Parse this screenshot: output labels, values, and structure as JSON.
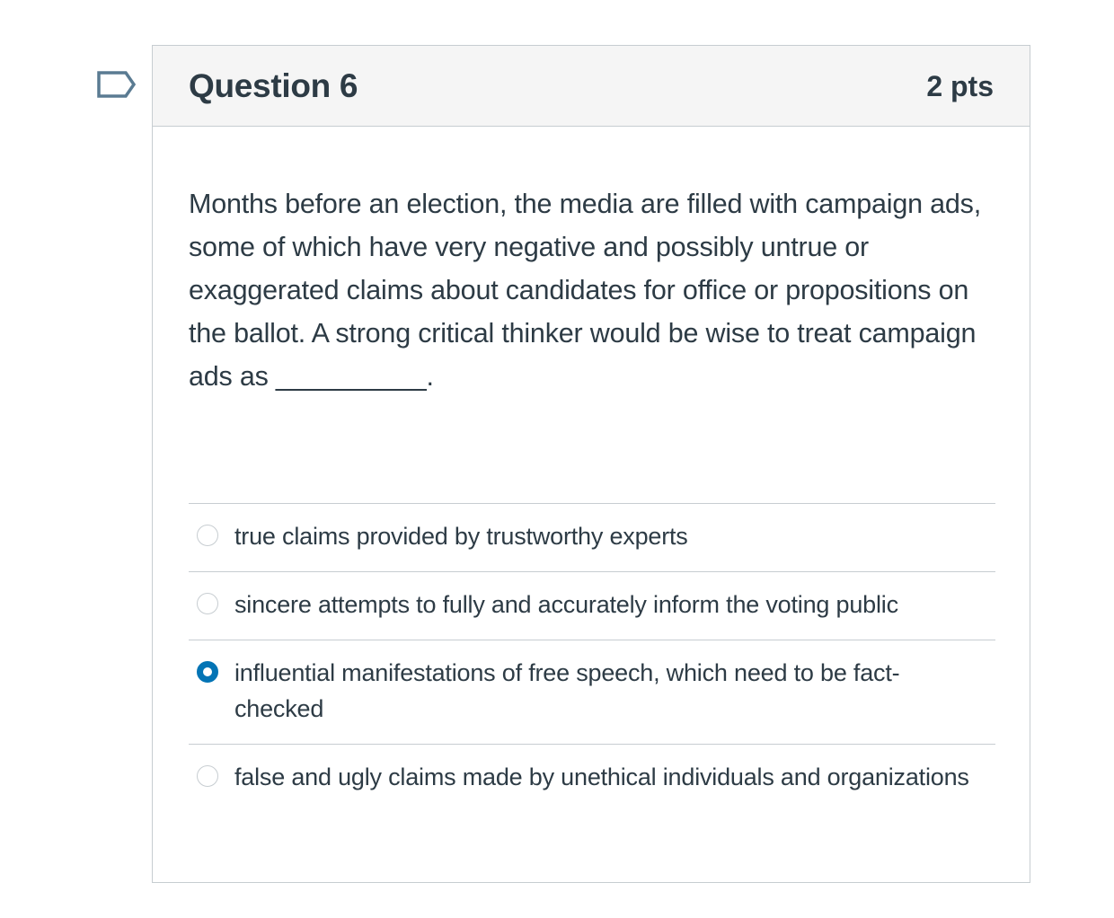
{
  "question": {
    "title": "Question 6",
    "points": "2 pts",
    "text": "Months before an election, the media are filled with campaign ads, some of which have very negative and possibly untrue or exaggerated claims about candidates for office or propositions on the ballot. A strong critical thinker would be wise to treat campaign ads as __________.",
    "flag_icon": "flag-question-icon"
  },
  "answers": [
    {
      "label": "true claims provided by trustworthy experts",
      "selected": false
    },
    {
      "label": "sincere attempts to fully and accurately inform the voting public",
      "selected": false
    },
    {
      "label": "influential manifestations of free speech, which need to be fact-checked",
      "selected": true
    },
    {
      "label": "false and ugly claims made by unethical individuals and organizations",
      "selected": false
    }
  ],
  "colors": {
    "accent": "#0374b5",
    "text": "#2d3b45",
    "border": "#c7cdd1",
    "header_bg": "#f5f5f5",
    "flag": "#5a7b92"
  }
}
